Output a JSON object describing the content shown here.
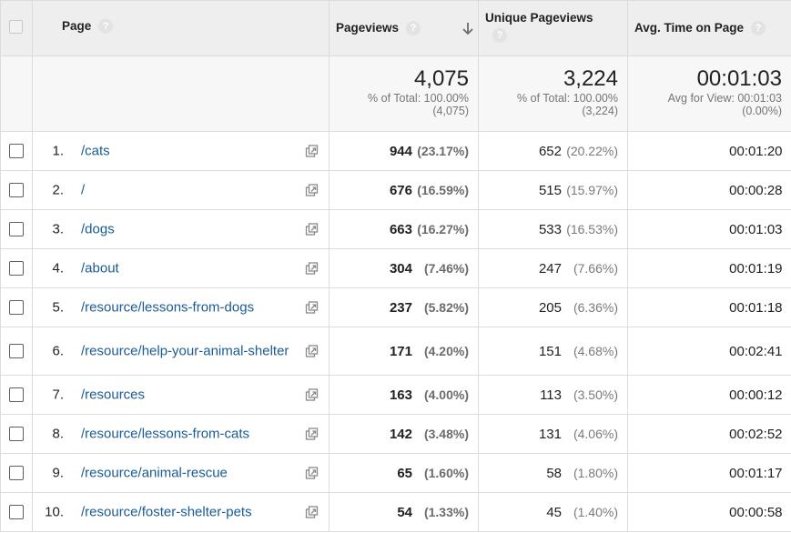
{
  "columns": {
    "page": "Page",
    "pageviews": "Pageviews",
    "unique_pageviews": "Unique Pageviews",
    "avg_time": "Avg. Time on Page"
  },
  "totals": {
    "pageviews": {
      "value": "4,075",
      "line1": "% of Total: 100.00%",
      "line2": "(4,075)"
    },
    "unique_pageviews": {
      "value": "3,224",
      "line1": "% of Total: 100.00%",
      "line2": "(3,224)"
    },
    "avg_time": {
      "value": "00:01:03",
      "line1": "Avg for View: 00:01:03",
      "line2": "(0.00%)"
    }
  },
  "rows": [
    {
      "index": "1.",
      "page": "/cats",
      "pageviews": "944",
      "pageviews_pct": "(23.17%)",
      "unique": "652",
      "unique_pct": "(20.22%)",
      "avg_time": "00:01:20"
    },
    {
      "index": "2.",
      "page": "/",
      "pageviews": "676",
      "pageviews_pct": "(16.59%)",
      "unique": "515",
      "unique_pct": "(15.97%)",
      "avg_time": "00:00:28"
    },
    {
      "index": "3.",
      "page": "/dogs",
      "pageviews": "663",
      "pageviews_pct": "(16.27%)",
      "unique": "533",
      "unique_pct": "(16.53%)",
      "avg_time": "00:01:03"
    },
    {
      "index": "4.",
      "page": "/about",
      "pageviews": "304",
      "pageviews_pct": "(7.46%)",
      "unique": "247",
      "unique_pct": "(7.66%)",
      "avg_time": "00:01:19"
    },
    {
      "index": "5.",
      "page": "/resource/lessons-from-dogs",
      "pageviews": "237",
      "pageviews_pct": "(5.82%)",
      "unique": "205",
      "unique_pct": "(6.36%)",
      "avg_time": "00:01:18"
    },
    {
      "index": "6.",
      "page": "/resource/help-your-animal-shelter",
      "pageviews": "171",
      "pageviews_pct": "(4.20%)",
      "unique": "151",
      "unique_pct": "(4.68%)",
      "avg_time": "00:02:41"
    },
    {
      "index": "7.",
      "page": "/resources",
      "pageviews": "163",
      "pageviews_pct": "(4.00%)",
      "unique": "113",
      "unique_pct": "(3.50%)",
      "avg_time": "00:00:12"
    },
    {
      "index": "8.",
      "page": "/resource/lessons-from-cats",
      "pageviews": "142",
      "pageviews_pct": "(3.48%)",
      "unique": "131",
      "unique_pct": "(4.06%)",
      "avg_time": "00:02:52"
    },
    {
      "index": "9.",
      "page": "/resource/animal-rescue",
      "pageviews": "65",
      "pageviews_pct": "(1.60%)",
      "unique": "58",
      "unique_pct": "(1.80%)",
      "avg_time": "00:01:17"
    },
    {
      "index": "10.",
      "page": "/resource/foster-shelter-pets",
      "pageviews": "54",
      "pageviews_pct": "(1.33%)",
      "unique": "45",
      "unique_pct": "(1.40%)",
      "avg_time": "00:00:58"
    }
  ],
  "icons": {
    "help": "question-mark-icon",
    "sort": "sort-descending-arrow-icon",
    "external": "open-in-new-window-icon"
  },
  "colors": {
    "link": "#1a5b93",
    "header_bg": "#eeeeee",
    "totals_bg": "#f7f7f7"
  }
}
